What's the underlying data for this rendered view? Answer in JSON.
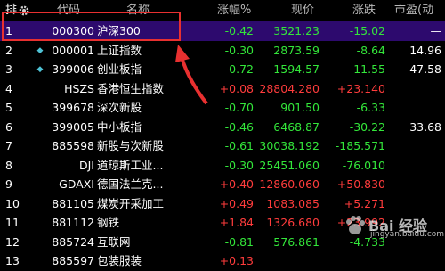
{
  "header": {
    "idx": "排",
    "gear_icon": "gear-icon",
    "code": "代码",
    "name": "名称",
    "pct": "涨幅%",
    "price": "现价",
    "chg": "涨跌",
    "pe": "市盈(动"
  },
  "rows": [
    {
      "idx": "1",
      "mark": "",
      "code": "000300",
      "name": "沪深300",
      "pct": "-0.42",
      "price": "3521.23",
      "chg": "-15.02",
      "pe": "—",
      "trend": "down"
    },
    {
      "idx": "2",
      "mark": "◆",
      "code": "000001",
      "name": "上证指数",
      "pct": "-0.30",
      "price": "2873.59",
      "chg": "-8.64",
      "pe": "14.96",
      "trend": "down"
    },
    {
      "idx": "3",
      "mark": "◆",
      "code": "399006",
      "name": "创业板指",
      "pct": "-0.72",
      "price": "1594.57",
      "chg": "-11.55",
      "pe": "47.58",
      "trend": "down"
    },
    {
      "idx": "4",
      "mark": "",
      "code": "HSZS",
      "name": "香港恒生指数",
      "pct": "+0.08",
      "price": "28804.280",
      "chg": "+23.140",
      "pe": "",
      "trend": "up"
    },
    {
      "idx": "5",
      "mark": "",
      "code": "399678",
      "name": "深次新股",
      "pct": "-0.70",
      "price": "901.50",
      "chg": "-6.33",
      "pe": "",
      "trend": "down"
    },
    {
      "idx": "6",
      "mark": "",
      "code": "399005",
      "name": "中小板指",
      "pct": "-0.46",
      "price": "6468.87",
      "chg": "-30.22",
      "pe": "33.68",
      "trend": "down"
    },
    {
      "idx": "7",
      "mark": "",
      "code": "885598",
      "name": "新股与次新股",
      "pct": "-0.61",
      "price": "30038.192",
      "chg": "-185.571",
      "pe": "",
      "trend": "down"
    },
    {
      "idx": "8",
      "mark": "",
      "code": "DJI",
      "name": "道琼斯工业...",
      "pct": "-0.30",
      "price": "25451.060",
      "chg": "-76.010",
      "pe": "",
      "trend": "down"
    },
    {
      "idx": "9",
      "mark": "",
      "code": "GDAXI",
      "name": "德国法兰克...",
      "pct": "+0.40",
      "price": "12860.060",
      "chg": "+50.830",
      "pe": "",
      "trend": "up"
    },
    {
      "idx": "10",
      "mark": "",
      "code": "881105",
      "name": "煤炭开采加工",
      "pct": "+0.49",
      "price": "1083.085",
      "chg": "+5.271",
      "pe": "",
      "trend": "up"
    },
    {
      "idx": "11",
      "mark": "",
      "code": "881112",
      "name": "钢铁",
      "pct": "+1.84",
      "price": "1326.680",
      "chg": "+23.992",
      "pe": "",
      "trend": "up"
    },
    {
      "idx": "12",
      "mark": "",
      "code": "885724",
      "name": "互联网",
      "pct": "-0.81",
      "price": "576.861",
      "chg": "-4.733",
      "pe": "",
      "trend": "down"
    },
    {
      "idx": "13",
      "mark": "",
      "code": "885597",
      "name": "包装服装",
      "pct": "+0.13",
      "price": "",
      "chg": "",
      "pe": "",
      "trend": "up"
    }
  ],
  "colors": {
    "up": "#ff3c3c",
    "down": "#33e63a",
    "highlight": "#e83030",
    "selected_bg": "#2d0a6e"
  },
  "watermark": {
    "text": "Bai 经验",
    "sub": "jingyan.baidu.com"
  }
}
